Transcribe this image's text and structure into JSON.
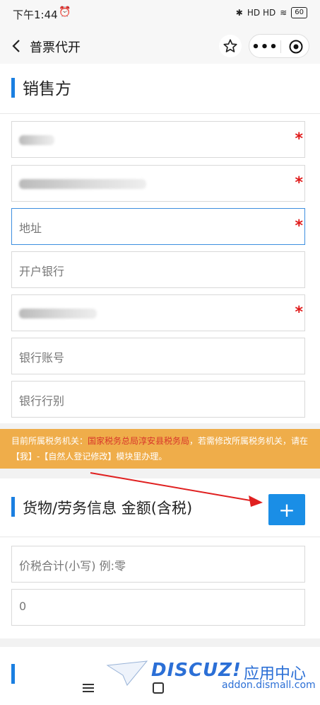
{
  "status_bar": {
    "time": "下午1:44",
    "alarm_icon": "alarm-icon",
    "right_text": "HD HD",
    "battery": "60"
  },
  "nav": {
    "title": "普票代开",
    "back_icon": "back-chevron-icon",
    "star_icon": "star-icon",
    "more_icon": "more-icon",
    "close_icon": "mini-program-close-icon"
  },
  "seller": {
    "title": "销售方",
    "fields": [
      {
        "value": "",
        "required": "*"
      },
      {
        "value": "",
        "required": "*"
      },
      {
        "value": "地址",
        "required": "*"
      },
      {
        "value": "开户银行",
        "required": ""
      },
      {
        "value": "",
        "required": "*"
      },
      {
        "value": "银行账号",
        "required": ""
      },
      {
        "value": "银行行别",
        "required": ""
      }
    ]
  },
  "notice": {
    "prefix": "目前所属税务机关：",
    "highlight": "国家税务总局淳安县税务局",
    "suffix": "，若需修改所属税务机关，请在【我】-【自然人登记修改】模块里办理。"
  },
  "goods": {
    "title": "货物/劳务信息 金额(含税)",
    "add_label": "+",
    "fields": [
      {
        "value": "价税合计(小写) 例:零"
      },
      {
        "value": "0"
      }
    ]
  },
  "watermark": {
    "logo": "DISCUZ!",
    "cn": "应用中心",
    "url": "addon.dismall.com"
  },
  "colors": {
    "accent": "#1a7fe1",
    "required": "#e01b1b",
    "notice_bg": "#efad4a",
    "arrow": "#e02020"
  }
}
